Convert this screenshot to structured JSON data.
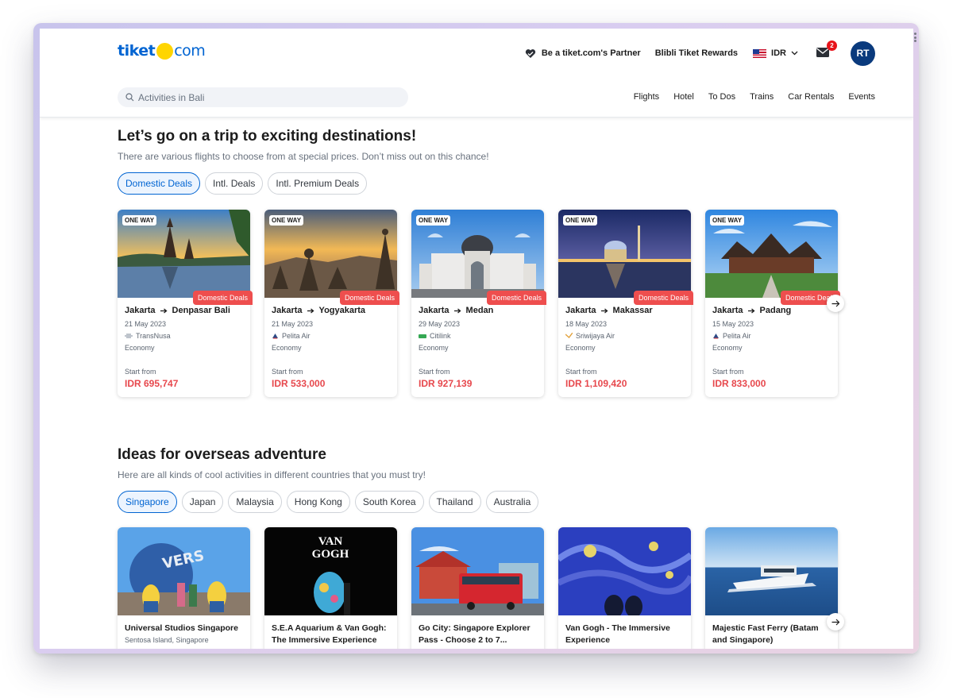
{
  "header": {
    "logo": {
      "brand_part1": "tiket",
      "brand_part2": "com"
    },
    "partner_link": "Be a tiket.com's Partner",
    "rewards_link": "Blibli Tiket Rewards",
    "currency": "IDR",
    "notification_count": "2",
    "avatar_initials": "RT",
    "search_placeholder": "Activities in Bali",
    "nav": [
      "Flights",
      "Hotel",
      "To Dos",
      "Trains",
      "Car Rentals",
      "Events"
    ]
  },
  "deals_section": {
    "title": "Let’s go on a trip to exciting destinations!",
    "subtitle": "There are various flights to choose from at special prices. Don’t miss out on this chance!",
    "tabs": [
      "Domestic Deals",
      "Intl. Deals",
      "Intl. Premium Deals"
    ],
    "active_tab": "Domestic Deals",
    "cards": [
      {
        "tag": "ONE WAY",
        "deal": "Domestic Deals",
        "from": "Jakarta",
        "to": "Denpasar Bali",
        "date": "21 May 2023",
        "airline": "TransNusa",
        "cabin": "Economy",
        "start_label": "Start from",
        "price": "IDR 695,747"
      },
      {
        "tag": "ONE WAY",
        "deal": "Domestic Deals",
        "from": "Jakarta",
        "to": "Yogyakarta",
        "date": "21 May 2023",
        "airline": "Pelita Air",
        "cabin": "Economy",
        "start_label": "Start from",
        "price": "IDR 533,000"
      },
      {
        "tag": "ONE WAY",
        "deal": "Domestic Deals",
        "from": "Jakarta",
        "to": "Medan",
        "date": "29 May 2023",
        "airline": "Citilink",
        "cabin": "Economy",
        "start_label": "Start from",
        "price": "IDR 927,139"
      },
      {
        "tag": "ONE WAY",
        "deal": "Domestic Deals",
        "from": "Jakarta",
        "to": "Makassar",
        "date": "18 May 2023",
        "airline": "Sriwijaya Air",
        "cabin": "Economy",
        "start_label": "Start from",
        "price": "IDR 1,109,420"
      },
      {
        "tag": "ONE WAY",
        "deal": "Domestic Deals",
        "from": "Jakarta",
        "to": "Padang",
        "date": "15 May 2023",
        "airline": "Pelita Air",
        "cabin": "Economy",
        "start_label": "Start from",
        "price": "IDR 833,000"
      }
    ]
  },
  "overseas_section": {
    "title": "Ideas for overseas adventure",
    "subtitle": "Here are all kinds of cool activities in different countries that you must try!",
    "tabs": [
      "Singapore",
      "Japan",
      "Malaysia",
      "Hong Kong",
      "South Korea",
      "Thailand",
      "Australia"
    ],
    "active_tab": "Singapore",
    "cards": [
      {
        "title": "Universal Studios Singapore",
        "location": "Sentosa Island, Singapore",
        "image_text": "VERS"
      },
      {
        "title": "S.E.A Aquarium & Van Gogh: The Immersive Experience",
        "location": "",
        "image_text": "VAN GOGH"
      },
      {
        "title": "Go City: Singapore Explorer Pass - Choose 2 to 7...",
        "location": "",
        "image_text": ""
      },
      {
        "title": "Van Gogh - The Immersive Experience",
        "location": "",
        "image_text": ""
      },
      {
        "title": "Majestic Fast Ferry (Batam and Singapore)",
        "location": "",
        "image_text": ""
      }
    ]
  },
  "colors": {
    "brand_blue": "#0064d2",
    "brand_yellow": "#ffd500",
    "deal_red": "#ee4e4e",
    "price_red": "#e7484d"
  }
}
